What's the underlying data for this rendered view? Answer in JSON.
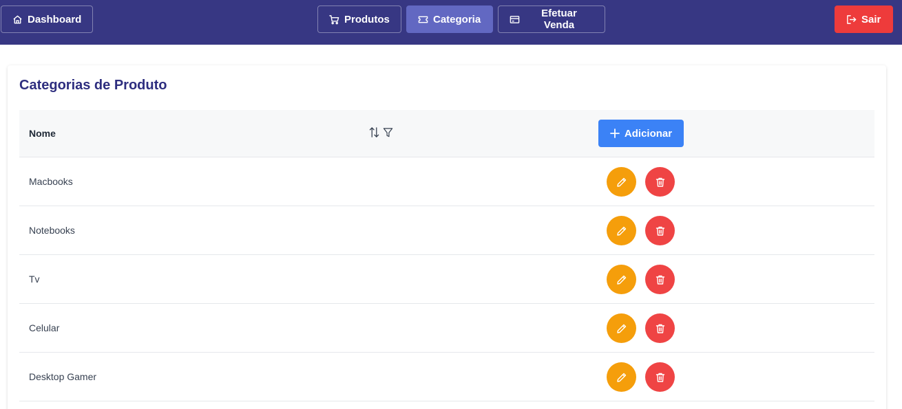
{
  "nav": {
    "dashboard": "Dashboard",
    "produtos": "Produtos",
    "categoria": "Categoria",
    "efetuar_venda": "Efetuar Venda",
    "sair": "Sair",
    "active_tab": "Categoria"
  },
  "page": {
    "title": "Categorias de Produto"
  },
  "table": {
    "column_name": "Nome",
    "add_label": "Adicionar",
    "rows": [
      {
        "name": "Macbooks"
      },
      {
        "name": "Notebooks"
      },
      {
        "name": "Tv"
      },
      {
        "name": "Celular"
      },
      {
        "name": "Desktop Gamer"
      }
    ]
  },
  "icons": {
    "dashboard": "home-icon",
    "produtos": "cart-icon",
    "categoria": "ticket-icon",
    "venda": "credit-card-icon",
    "sair": "sign-out-icon",
    "sort": "sort-icon",
    "filter": "filter-icon",
    "add": "plus-icon",
    "edit": "pencil-icon",
    "delete": "trash-icon"
  },
  "colors": {
    "topbar": "#373783",
    "active_tab": "#6268c2",
    "logout": "#ee3b3b",
    "title": "#2e2e7f",
    "add_button": "#3b82f6",
    "edit_button": "#f59e0b",
    "delete_button": "#ef4444"
  }
}
